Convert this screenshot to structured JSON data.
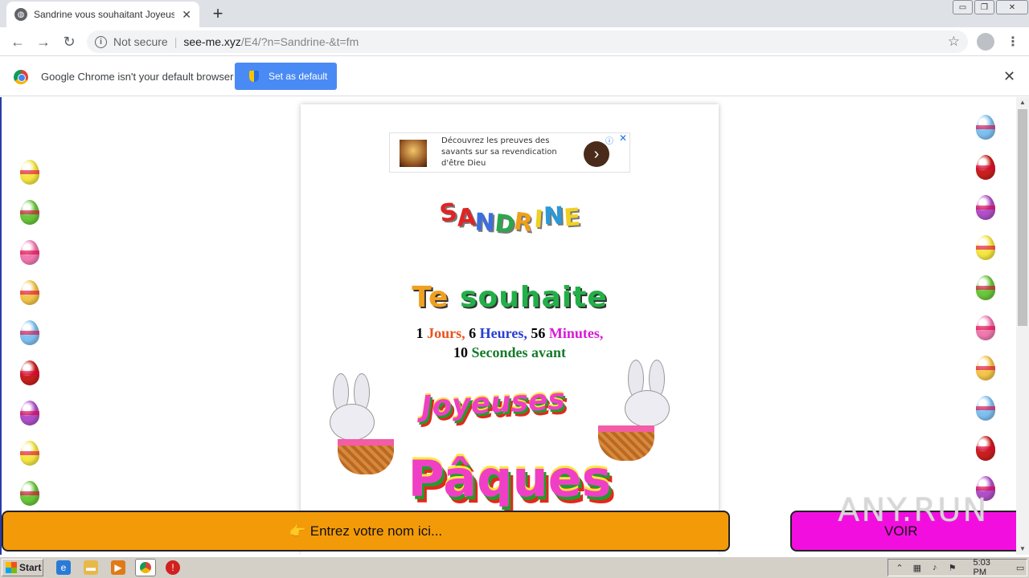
{
  "browser": {
    "tab_title": "Sandrine vous souhaitant Joyeuses Pâques",
    "tab_close": "✕",
    "new_tab": "+",
    "url_security": "Not secure",
    "url_host": "see-me.xyz",
    "url_path": "/E4/?n=Sandrine-&t=fm",
    "back": "←",
    "forward": "→",
    "reload": "↻",
    "star": "☆",
    "menu": "⋮",
    "win_minimize": "▭",
    "win_restore": "❐",
    "win_close": "✕"
  },
  "infobar": {
    "message": "Google Chrome isn't your default browser",
    "button": "Set as default",
    "close": "✕"
  },
  "ad": {
    "text": "Découvrez les preuves des savants sur sa revendication d'être Dieu",
    "arrow": "›",
    "info": "ⓘ",
    "close": "✕"
  },
  "page": {
    "name_letters": [
      "S",
      "A",
      "N",
      "D",
      "R",
      "I",
      "N",
      "E"
    ],
    "name_colors": [
      "#e02424",
      "#e02424",
      "#3b6fe0",
      "#2aa84a",
      "#f0a018",
      "#f0d020",
      "#2a9ad8",
      "#f2d020"
    ],
    "souhaite_words": [
      "Te",
      "souhaite"
    ],
    "countdown": {
      "days": "1",
      "days_label": "Jours,",
      "hours": "6",
      "hours_label": "Heures,",
      "minutes": "56",
      "minutes_label": "Minutes,",
      "seconds": "10",
      "seconds_label": "Secondes avant"
    },
    "joyeuses": "Joyeuses",
    "paques": "Pâques",
    "name_input": "👉 Entrez votre nom ici...",
    "voir": "VOIR",
    "watermark": "ANY.RUN"
  },
  "eggs_left": [
    "#f5e642",
    "#6ac63c",
    "#f07ab0",
    "#f3c54a",
    "#7fc0f0",
    "#c8201e",
    "#b050c8",
    "#f5e642",
    "#6ac63c"
  ],
  "eggs_right": [
    "#7fc0f0",
    "#c8201e",
    "#b050c8",
    "#f5e642",
    "#6ac63c",
    "#f07ab0",
    "#f3c54a",
    "#7fc0f0",
    "#c8201e",
    "#b050c8"
  ],
  "taskbar": {
    "start": "Start",
    "clock": "5:03 PM"
  }
}
